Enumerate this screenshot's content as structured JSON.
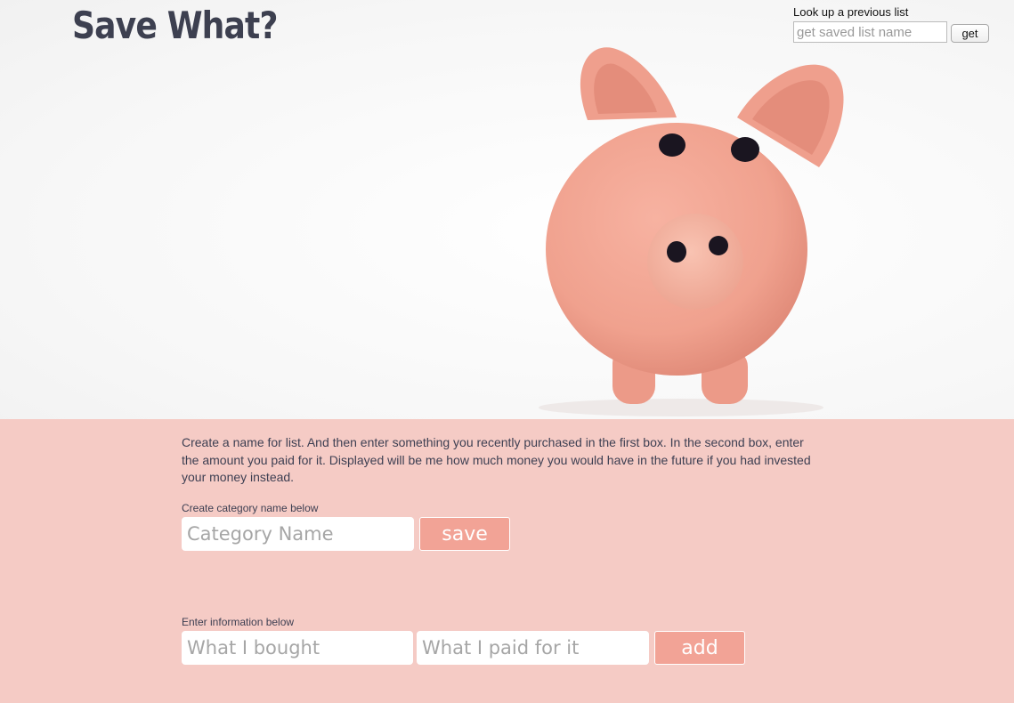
{
  "header": {
    "title": "Save What?"
  },
  "lookup": {
    "label": "Look up a previous list",
    "placeholder": "get saved list name",
    "button_label": "get"
  },
  "intro": {
    "text": "Create a name for list. And then enter something you recently purchased in the first box. In the second box, enter the amount you paid for it. Displayed will be me how much money you would have in the future if you had invested your money instead."
  },
  "category": {
    "label": "Create category name below",
    "placeholder": "Category Name",
    "button_label": "save"
  },
  "entry": {
    "label": "Enter information below",
    "item_placeholder": "What I bought",
    "amount_placeholder": "What I paid for it",
    "button_label": "add"
  },
  "colors": {
    "panel_background": "#f5cbc5",
    "button_background": "#f2a396",
    "title_color": "#3d4050"
  }
}
